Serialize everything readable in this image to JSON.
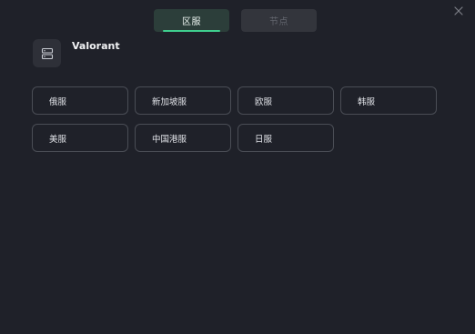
{
  "tabs": [
    {
      "label": "区服",
      "active": true
    },
    {
      "label": "节点",
      "active": false
    }
  ],
  "game": {
    "title": "Valorant",
    "icon": "server-icon"
  },
  "servers": [
    {
      "label": "俄服"
    },
    {
      "label": "新加坡服"
    },
    {
      "label": "欧服"
    },
    {
      "label": "韩服"
    },
    {
      "label": "美服"
    },
    {
      "label": "中国港服"
    },
    {
      "label": "日服"
    }
  ],
  "colors": {
    "background": "#1f2129",
    "accent": "#3fcf8e",
    "active_tab_bg": "#2c3e3a",
    "inactive_tab_bg": "#33353c",
    "button_border": "#4a4d55"
  }
}
